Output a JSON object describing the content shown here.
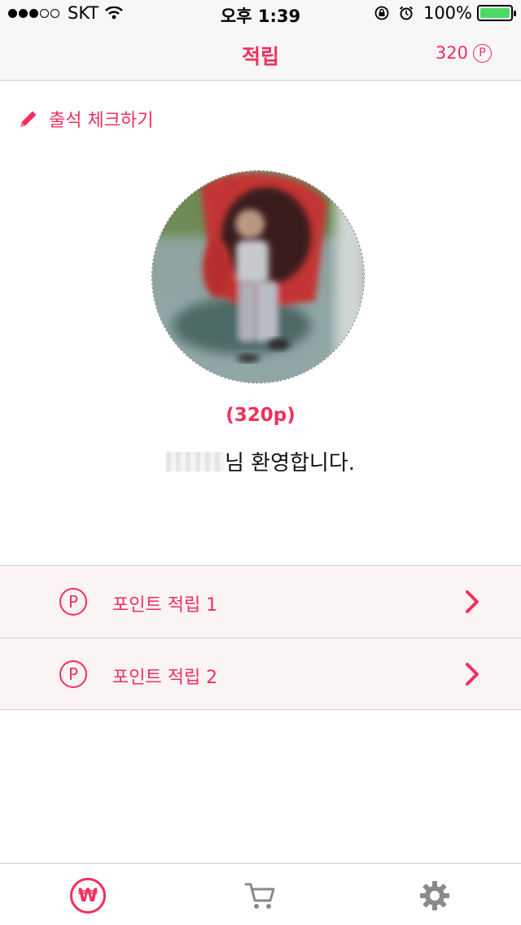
{
  "status_bar": {
    "carrier": "SKT",
    "time": "오후 1:39",
    "battery": "100%",
    "battery_level": 1.0
  },
  "nav": {
    "title": "적립",
    "points": "320",
    "points_badge": "P"
  },
  "attendance": {
    "label": "출석 체크하기",
    "icon": "pencil-icon"
  },
  "profile": {
    "points_text": "(320p)",
    "welcome_suffix": "님 환영합니다."
  },
  "list": {
    "items": [
      {
        "badge": "P",
        "label": "포인트 적립 1"
      },
      {
        "badge": "P",
        "label": "포인트 적립 2"
      }
    ]
  },
  "tabs": {
    "won_symbol": "₩",
    "icons": [
      "won-icon",
      "cart-icon",
      "gear-icon"
    ]
  },
  "colors": {
    "accent": "#f0305c",
    "row_bg": "#fbf4f4",
    "bar_bg": "#f7f7f7",
    "battery": "#4cd964"
  }
}
